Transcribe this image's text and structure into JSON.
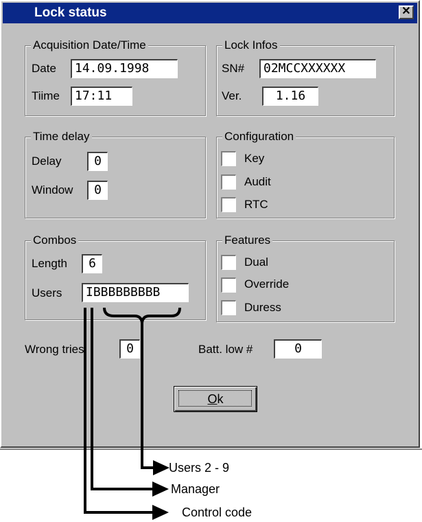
{
  "window": {
    "title": "Lock status",
    "close_symbol": "✕"
  },
  "acquisition": {
    "legend": "Acquisition Date/Time",
    "date_label": "Date",
    "date_value": "14.09.1998",
    "time_label": "Tiime",
    "time_value": "17:11"
  },
  "lock_infos": {
    "legend": "Lock Infos",
    "sn_label": "SN#",
    "sn_value": "02MCCXXXXXX",
    "ver_label": "Ver.",
    "ver_value": "1.16"
  },
  "time_delay": {
    "legend": "Time delay",
    "delay_label": "Delay",
    "delay_value": "0",
    "window_label": "Window",
    "window_value": "0"
  },
  "configuration": {
    "legend": "Configuration",
    "options": [
      {
        "label": "Key",
        "checked": false
      },
      {
        "label": "Audit",
        "checked": false
      },
      {
        "label": "RTC",
        "checked": false
      }
    ]
  },
  "combos": {
    "legend": "Combos",
    "length_label": "Length",
    "length_value": "6",
    "users_label": "Users",
    "users_value": "IBBBBBBBBB"
  },
  "features": {
    "legend": "Features",
    "options": [
      {
        "label": "Dual",
        "checked": false
      },
      {
        "label": "Override",
        "checked": false
      },
      {
        "label": "Duress",
        "checked": false
      }
    ]
  },
  "footer": {
    "wrong_tries_label": "Wrong tries",
    "wrong_tries_value": "0",
    "batt_low_label": "Batt. low #",
    "batt_low_value": "0",
    "ok_label_first": "O",
    "ok_label_rest": "k"
  },
  "annotations": {
    "users_2_9": "Users 2 - 9",
    "manager": "Manager",
    "control_code": "Control code"
  },
  "icons": {
    "close": "close-icon",
    "arrow": "arrow-right-icon"
  }
}
